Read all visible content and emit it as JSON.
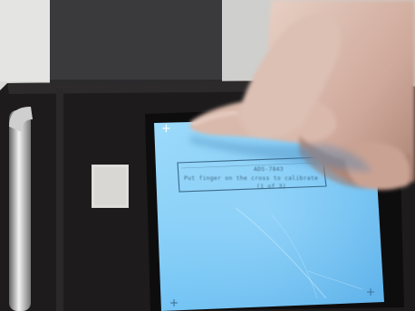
{
  "photo": {
    "subject": "finger-touching-touchscreen-calibration",
    "screen_color": "#77c6f5"
  },
  "calibration_screen": {
    "text_line_1": "ADS-7843",
    "text_line_2": "Put finger on the cross to calibrate",
    "text_line_3": "(1 of 3)",
    "target_glyph": "+"
  }
}
